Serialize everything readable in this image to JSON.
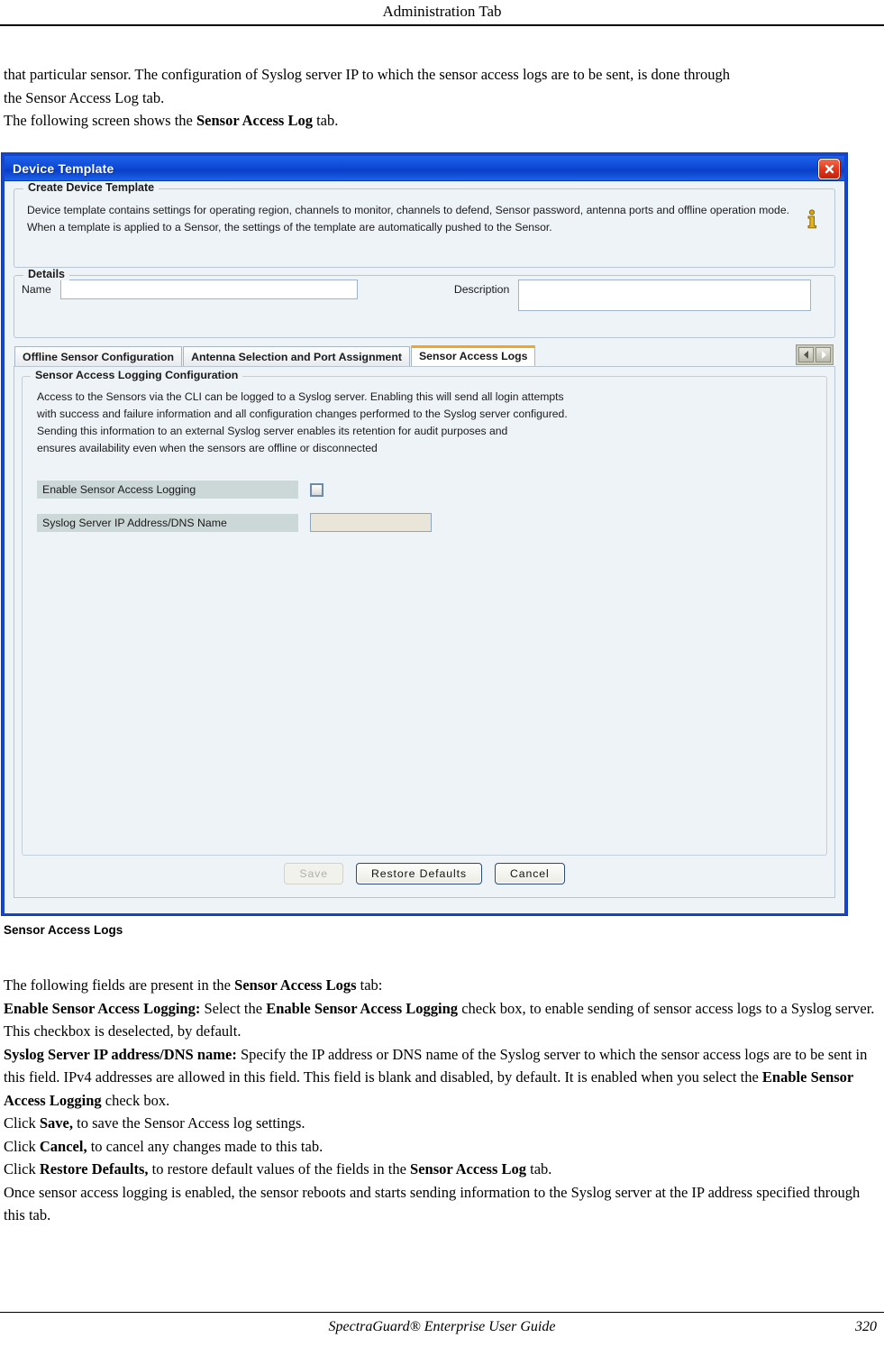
{
  "page_header": {
    "title": "Administration Tab"
  },
  "intro": {
    "line1": "that particular sensor. The configuration of Syslog server IP to which the sensor access logs are to be sent, is done through",
    "line2": "the Sensor Access Log tab.",
    "line3_pre": "The following screen shows the ",
    "line3_bold": "Sensor Access Log",
    "line3_post": " tab."
  },
  "dialog": {
    "title": "Device Template",
    "close_icon": "close-icon",
    "create_group": {
      "legend": "Create Device Template",
      "description": "Device template contains settings for operating region, channels to monitor, channels to defend, Sensor password, antenna ports and offline operation mode. When a template is applied to a Sensor, the settings of the template are automatically pushed to the Sensor.",
      "info_icon": "info-icon"
    },
    "details_group": {
      "legend": "Details",
      "name_label": "Name",
      "name_value": "",
      "description_label": "Description",
      "description_value": ""
    },
    "tabs": [
      {
        "label": "Offline Sensor Configuration",
        "active": false
      },
      {
        "label": "Antenna Selection and Port Assignment",
        "active": false
      },
      {
        "label": "Sensor Access Logs",
        "active": true
      }
    ],
    "tab_scroll": {
      "left_icon": "chevron-left-icon",
      "right_icon": "chevron-right-icon"
    },
    "panel": {
      "legend": "Sensor Access Logging Configuration",
      "desc_line1": "Access to the Sensors via the CLI can be logged to a Syslog server. Enabling this will send all login attempts",
      "desc_line2": "with success and failure information and all configuration changes performed to the Syslog server configured.",
      "desc_line3": "Sending this information to an external Syslog server enables its retention for audit purposes and",
      "desc_line4": "ensures availability even when the sensors are offline or disconnected",
      "enable_label": "Enable Sensor Access Logging",
      "enable_checked": false,
      "syslog_label": "Syslog Server IP Address/DNS Name",
      "syslog_value": ""
    },
    "buttons": {
      "save": "Save",
      "save_disabled": true,
      "restore_defaults": "Restore Defaults",
      "cancel": "Cancel"
    },
    "accent_color": "#f7a521",
    "titlebar_color": "#0f49d8",
    "border_color": "#1546cf"
  },
  "figure_caption": "Sensor Access Logs",
  "body_text": {
    "l1_pre": "The following fields are present in the ",
    "l1_bold": "Sensor Access Logs",
    "l1_post": " tab:",
    "l2_bold1": "Enable Sensor Access Logging:",
    "l2_mid1": " Select the ",
    "l2_bold2": "Enable Sensor Access Logging",
    "l2_post": " check box, to enable sending of sensor access logs to a Syslog server. This checkbox is deselected, by default.",
    "l3_bold1": "Syslog Server IP address/DNS name:",
    "l3_mid1": " Specify the IP address or DNS name of the Syslog server to which the sensor access logs are to be sent in this field.  IPv4 addresses are allowed in this field. This field is blank and disabled, by default. It is enabled when you select the ",
    "l3_bold2": "Enable Sensor Access Logging",
    "l3_post": " check box.",
    "l4_pre": "Click ",
    "l4_bold": "Save,",
    "l4_post": " to save the Sensor Access log settings.",
    "l5_pre": "Click ",
    "l5_bold": "Cancel,",
    "l5_post": " to cancel any changes made to this tab.",
    "l6_pre": "Click ",
    "l6_bold": "Restore Defaults,",
    "l6_mid": " to restore default values of the fields in the ",
    "l6_bold2": "Sensor Access Log",
    "l6_post": " tab.",
    "l7": "Once sensor access logging is enabled, the sensor reboots and starts sending information to the Syslog server at the IP address specified through this tab."
  },
  "footer": {
    "title": "SpectraGuard®  Enterprise User Guide",
    "page_number": "320"
  }
}
